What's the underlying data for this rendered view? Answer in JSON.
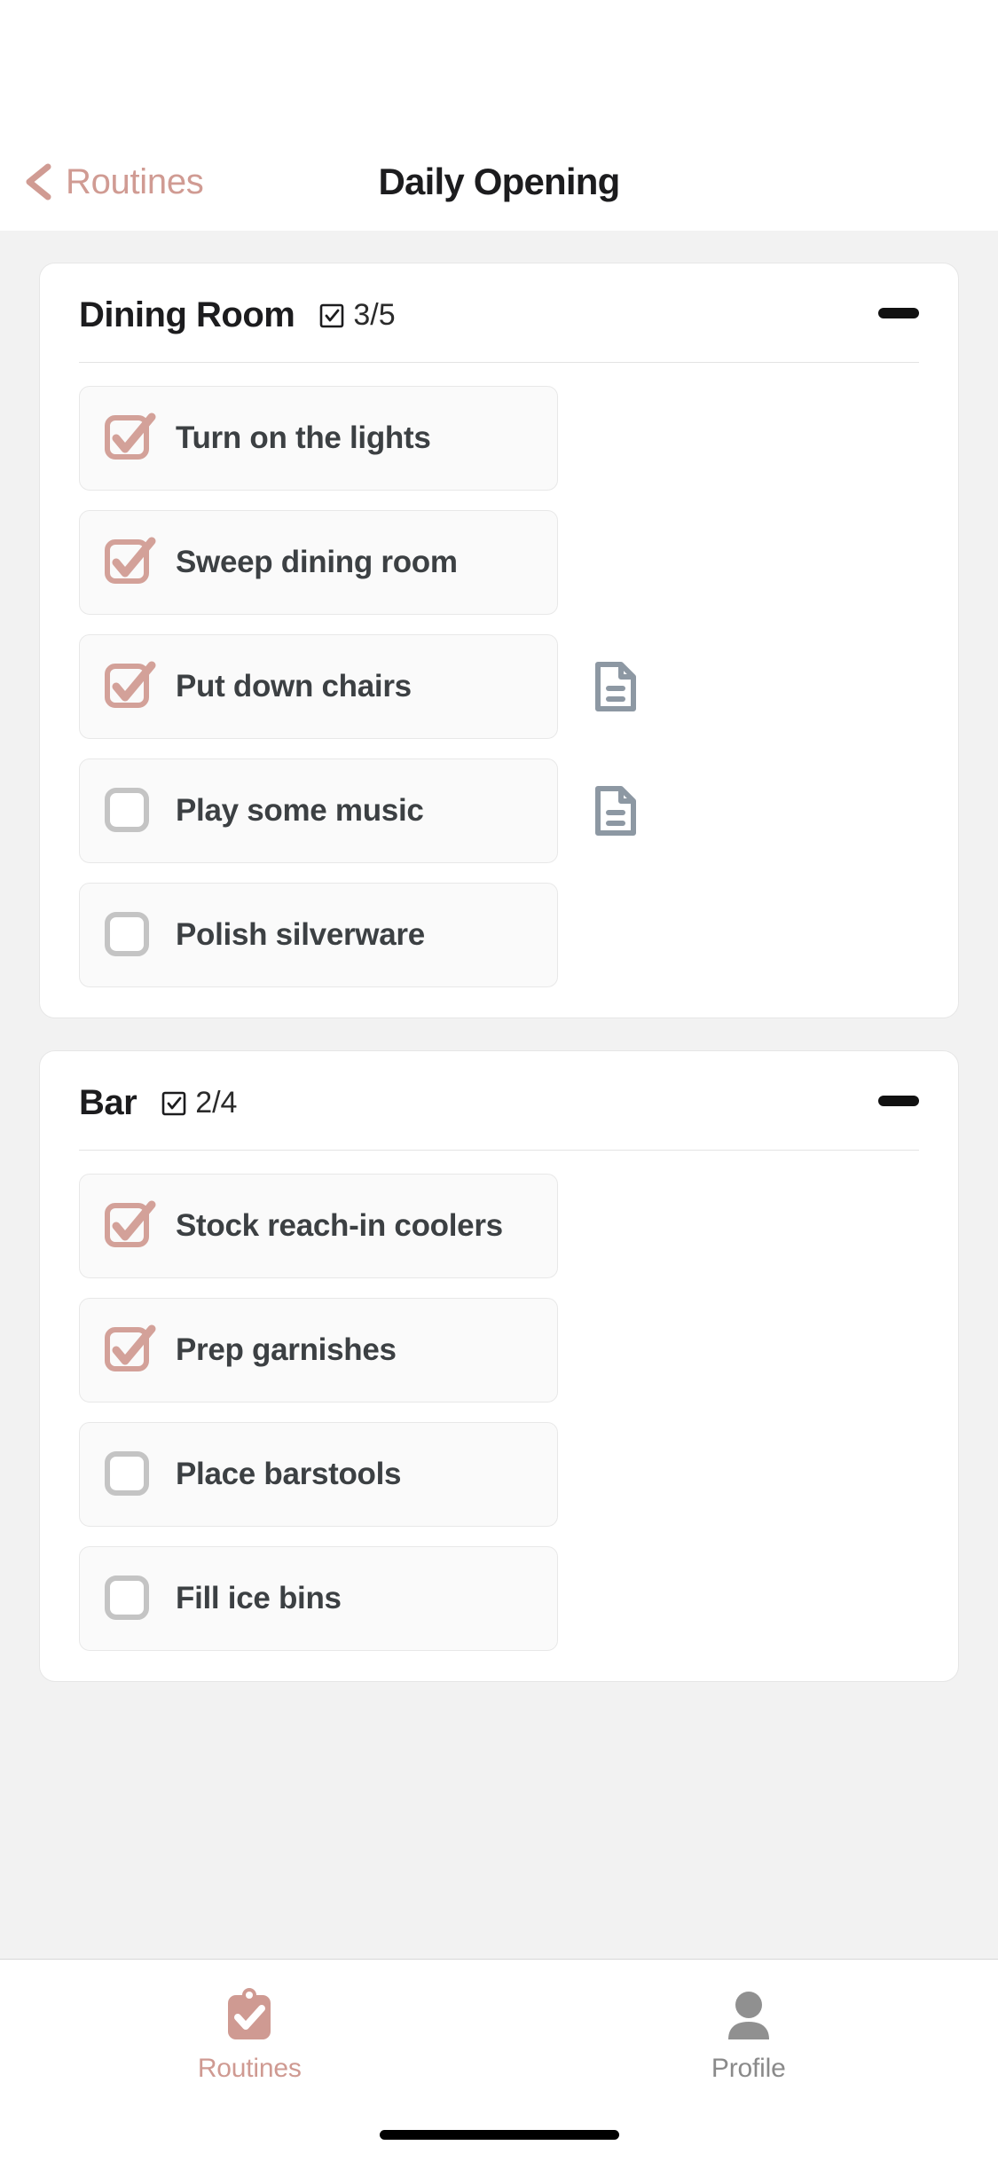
{
  "theme": {
    "accent": "#cf9a92",
    "checked_color": "#d3a199",
    "unchecked_border": "#c4c4c4",
    "note_icon_color": "#8d98a3",
    "text_dark": "#3c4043",
    "title_color": "#1c1c1e",
    "page_bg": "#f2f2f2",
    "card_bg": "#ffffff",
    "task_bg": "#fafafa"
  },
  "header": {
    "back_label": "Routines",
    "back_icon": "chevron-left-icon",
    "title": "Daily Opening"
  },
  "sections": [
    {
      "title": "Dining Room",
      "count_icon": "checkbox-checked-icon",
      "count": "3/5",
      "collapse_icon": "minus-icon",
      "tasks": [
        {
          "label": "Turn on the lights",
          "checked": true,
          "has_note": false
        },
        {
          "label": "Sweep dining room",
          "checked": true,
          "has_note": false
        },
        {
          "label": "Put down chairs",
          "checked": true,
          "has_note": true
        },
        {
          "label": "Play some music",
          "checked": false,
          "has_note": true
        },
        {
          "label": "Polish silverware",
          "checked": false,
          "has_note": false
        }
      ]
    },
    {
      "title": "Bar",
      "count_icon": "checkbox-checked-icon",
      "count": "2/4",
      "collapse_icon": "minus-icon",
      "tasks": [
        {
          "label": "Stock reach-in coolers",
          "checked": true,
          "has_note": false
        },
        {
          "label": "Prep garnishes",
          "checked": true,
          "has_note": false
        },
        {
          "label": "Place barstools",
          "checked": false,
          "has_note": false
        },
        {
          "label": "Fill ice bins",
          "checked": false,
          "has_note": false
        }
      ]
    }
  ],
  "tab_bar": {
    "items": [
      {
        "label": "Routines",
        "icon": "clipboard-check-icon",
        "active": true
      },
      {
        "label": "Profile",
        "icon": "person-icon",
        "active": false
      }
    ]
  }
}
